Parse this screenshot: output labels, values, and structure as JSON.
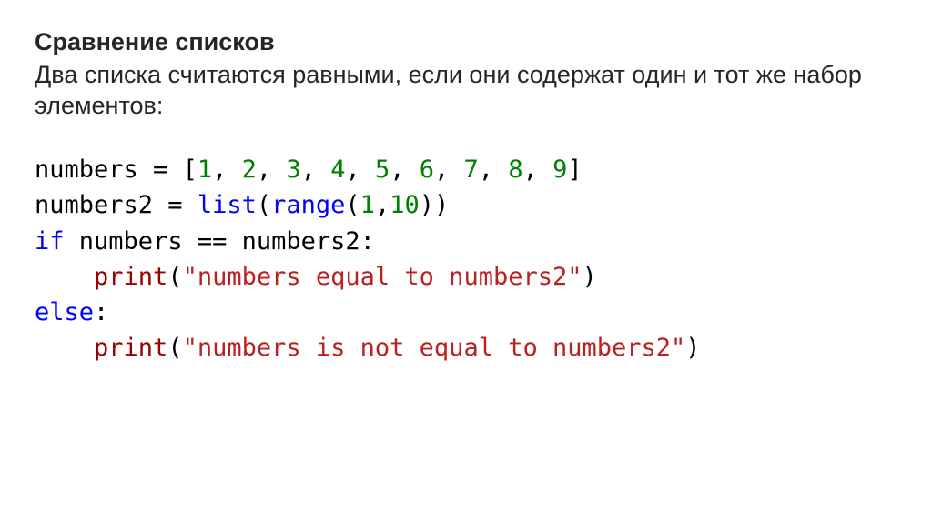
{
  "heading": "Сравнение списков",
  "intro": "Два списка считаются равными, если они содержат один и тот же набор элементов:",
  "code": {
    "l1": {
      "v": "numbers",
      "eq": " = ",
      "ob": "[",
      "cb": "]",
      "n1": "1",
      "n2": "2",
      "n3": "3",
      "n4": "4",
      "n5": "5",
      "n6": "6",
      "n7": "7",
      "n8": "8",
      "n9": "9",
      "sep": ", "
    },
    "l2": {
      "v": "numbers2",
      "eq": " = ",
      "list": "list",
      "range": "range",
      "op": "(",
      "cp": ")",
      "a1": "1",
      "c": ",",
      "a2": "10"
    },
    "l3": {
      "kw": "if",
      "sp": " ",
      "a": "numbers",
      "op": " == ",
      "b": "numbers2",
      "colon": ":"
    },
    "l4": {
      "indent": "    ",
      "fn": "print",
      "op": "(",
      "cp": ")",
      "q": "\"",
      "s": "numbers equal to numbers2"
    },
    "l5": {
      "kw": "else",
      "colon": ":"
    },
    "l6": {
      "indent": "    ",
      "fn": "print",
      "op": "(",
      "cp": ")",
      "q": "\"",
      "s": "numbers is not equal to numbers2"
    }
  }
}
